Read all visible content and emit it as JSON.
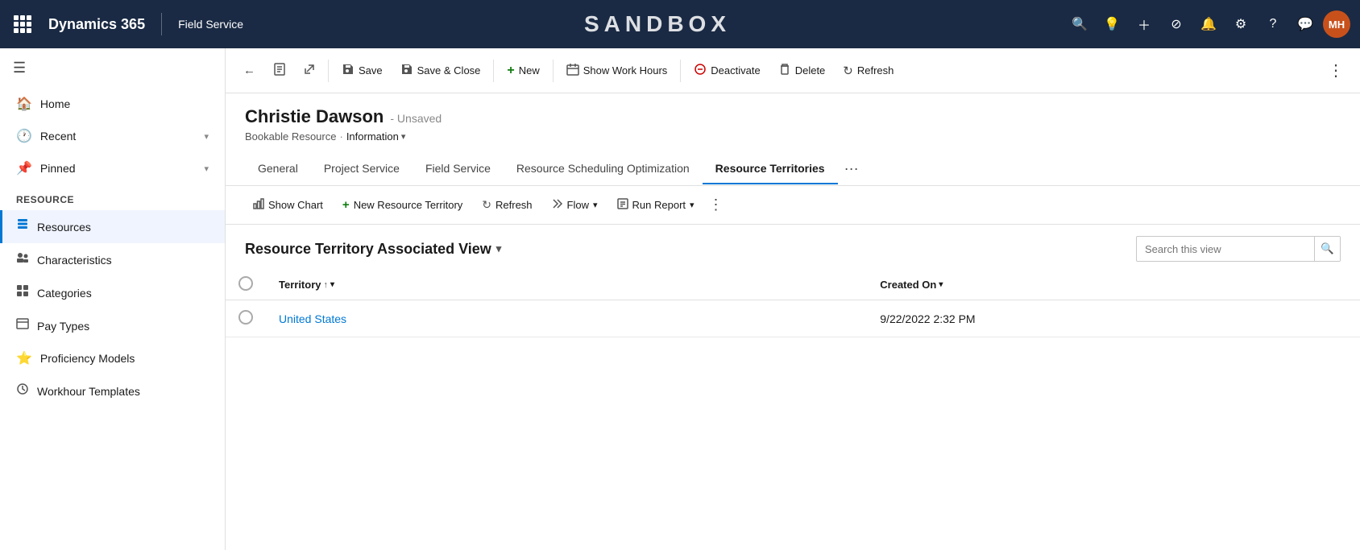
{
  "topnav": {
    "brand": "Dynamics 365",
    "module": "Field Service",
    "sandbox_label": "SANDBOX",
    "avatar_initials": "MH"
  },
  "sidebar": {
    "nav_items": [
      {
        "id": "home",
        "label": "Home",
        "icon": "🏠"
      },
      {
        "id": "recent",
        "label": "Recent",
        "icon": "🕐",
        "has_chevron": true
      },
      {
        "id": "pinned",
        "label": "Pinned",
        "icon": "📌",
        "has_chevron": true
      }
    ],
    "section_label": "Resource",
    "resource_items": [
      {
        "id": "resources",
        "label": "Resources",
        "icon": "👤",
        "active": true
      },
      {
        "id": "characteristics",
        "label": "Characteristics",
        "icon": "📋"
      },
      {
        "id": "categories",
        "label": "Categories",
        "icon": "📊"
      },
      {
        "id": "pay-types",
        "label": "Pay Types",
        "icon": "📄"
      },
      {
        "id": "proficiency-models",
        "label": "Proficiency Models",
        "icon": "⭐"
      },
      {
        "id": "workhour-templates",
        "label": "Workhour Templates",
        "icon": "⏱"
      }
    ]
  },
  "toolbar": {
    "back_label": "",
    "save_label": "Save",
    "save_close_label": "Save & Close",
    "new_label": "New",
    "show_work_hours_label": "Show Work Hours",
    "deactivate_label": "Deactivate",
    "delete_label": "Delete",
    "refresh_label": "Refresh"
  },
  "record": {
    "name": "Christie Dawson",
    "unsaved": "- Unsaved",
    "entity": "Bookable Resource",
    "form": "Information"
  },
  "tabs": [
    {
      "id": "general",
      "label": "General",
      "active": false
    },
    {
      "id": "project-service",
      "label": "Project Service",
      "active": false
    },
    {
      "id": "field-service",
      "label": "Field Service",
      "active": false
    },
    {
      "id": "rso",
      "label": "Resource Scheduling Optimization",
      "active": false
    },
    {
      "id": "resource-territories",
      "label": "Resource Territories",
      "active": true
    }
  ],
  "sub_toolbar": {
    "show_chart_label": "Show Chart",
    "new_territory_label": "New Resource Territory",
    "refresh_label": "Refresh",
    "flow_label": "Flow",
    "run_report_label": "Run Report"
  },
  "view": {
    "title": "Resource Territory Associated View",
    "search_placeholder": "Search this view"
  },
  "table": {
    "columns": [
      {
        "id": "territory",
        "label": "Territory",
        "sortable": true
      },
      {
        "id": "created_on",
        "label": "Created On",
        "sortable": true
      }
    ],
    "rows": [
      {
        "territory": "United States",
        "created_on": "9/22/2022 2:32 PM"
      }
    ]
  }
}
